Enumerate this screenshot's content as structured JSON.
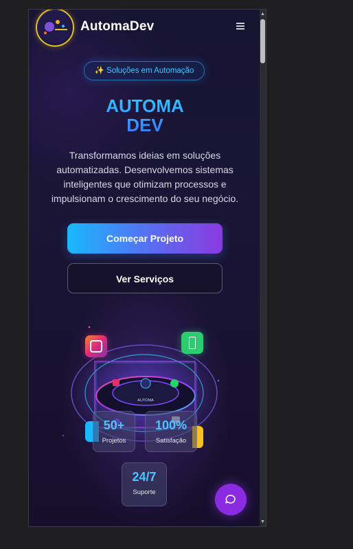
{
  "header": {
    "brand": "AutomaDev",
    "menu_icon": "hamburger-menu-icon",
    "logo_icon": "automadev-logo-icon"
  },
  "badge": {
    "icon": "sparkles-icon",
    "text": "✨ Soluções em Automação"
  },
  "hero": {
    "title_line1": "AUTOMA",
    "title_line2": "DEV",
    "description": "Transformamos ideias em soluções automatizadas. Desenvolvemos sistemas inteligentes que otimizam processos e impulsionam o crescimento do seu negócio."
  },
  "actions": {
    "primary": "Começar Projeto",
    "secondary": "Ver Serviços"
  },
  "illustration": {
    "center_label": "AUTOMA"
  },
  "stats": [
    {
      "value": "50+",
      "label": "Projetos"
    },
    {
      "value": "100%",
      "label": "Satisfação"
    },
    {
      "value": "24/7",
      "label": "Suporte"
    }
  ],
  "chat": {
    "icon": "chat-bubble-icon"
  },
  "colors": {
    "accent_cyan": "#1ab8ff",
    "accent_purple": "#8a2be2",
    "badge_text": "#42c6ff",
    "logo_ring": "#e8c21f"
  }
}
